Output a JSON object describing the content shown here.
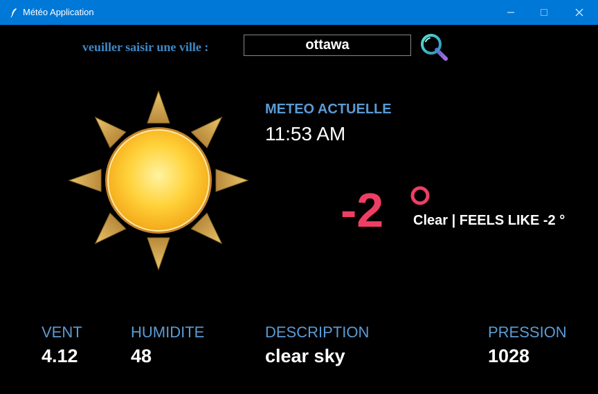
{
  "window": {
    "title": "Météo Application",
    "controls": [
      "minimize-icon",
      "maximize-icon",
      "close-icon"
    ]
  },
  "search": {
    "label": "veuiller saisir une ville :",
    "value": "ottawa",
    "button_icon": "search-icon"
  },
  "weather_icon": "sun-icon",
  "current": {
    "title": "METEO ACTUELLE",
    "time": "11:53 AM",
    "temperature": "-2",
    "degree_icon": "degree-icon",
    "summary": "Clear | FEELS LIKE -2 °"
  },
  "stats": {
    "vent": {
      "label": "VENT",
      "value": "4.12"
    },
    "humidite": {
      "label": "HUMIDITE",
      "value": "48"
    },
    "description": {
      "label": "DESCRIPTION",
      "value": "clear sky"
    },
    "pression": {
      "label": "PRESSION",
      "value": "1028"
    }
  },
  "colors": {
    "titlebar": "#0078d7",
    "background": "#000000",
    "label_blue": "#5b9bd5",
    "temperature": "#ef3e64",
    "text": "#ffffff"
  }
}
